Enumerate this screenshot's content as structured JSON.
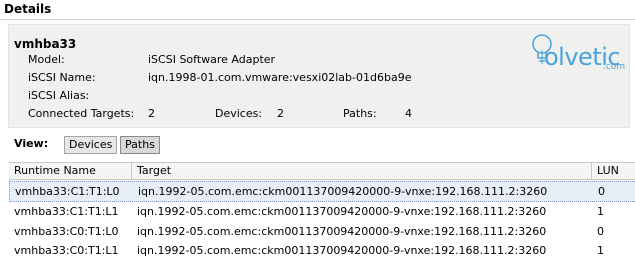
{
  "title": "Details",
  "adapter": {
    "name": "vmhba33",
    "model_label": "Model:",
    "model_value": "iSCSI Software Adapter",
    "iscsi_name_label": "iSCSI Name:",
    "iscsi_name_value": "iqn.1998-01.com.vmware:vesxi02lab-01d6ba9e",
    "iscsi_alias_label": "iSCSI Alias:",
    "connected_targets_label": "Connected Targets:",
    "connected_targets_value": "2",
    "devices_label": "Devices:",
    "devices_value": "2",
    "paths_label": "Paths:",
    "paths_value": "4"
  },
  "logo": {
    "text": "olvetic",
    "suffix": ".com"
  },
  "view": {
    "label": "View:",
    "devices_button": "Devices",
    "paths_button": "Paths",
    "active": "Paths"
  },
  "table": {
    "columns": [
      "Runtime Name",
      "Target",
      "LUN"
    ],
    "rows": [
      {
        "runtime_name": "vmhba33:C1:T1:L0",
        "target": "iqn.1992-05.com.emc:ckm001137009420000-9-vnxe:192.168.111.2:3260",
        "lun": "0"
      },
      {
        "runtime_name": "vmhba33:C1:T1:L1",
        "target": "iqn.1992-05.com.emc:ckm001137009420000-9-vnxe:192.168.111.2:3260",
        "lun": "1"
      },
      {
        "runtime_name": "vmhba33:C0:T1:L0",
        "target": "iqn.1992-05.com.emc:ckm001137009420000-9-vnxe:192.168.111.2:3260",
        "lun": "0"
      },
      {
        "runtime_name": "vmhba33:C0:T1:L1",
        "target": "iqn.1992-05.com.emc:ckm001137009420000-9-vnxe:192.168.111.2:3260",
        "lun": "1"
      }
    ]
  },
  "colors": {
    "selected_row": "#e8eef7",
    "panel": "#f0f0ee",
    "logo": "#4ba3d8"
  }
}
